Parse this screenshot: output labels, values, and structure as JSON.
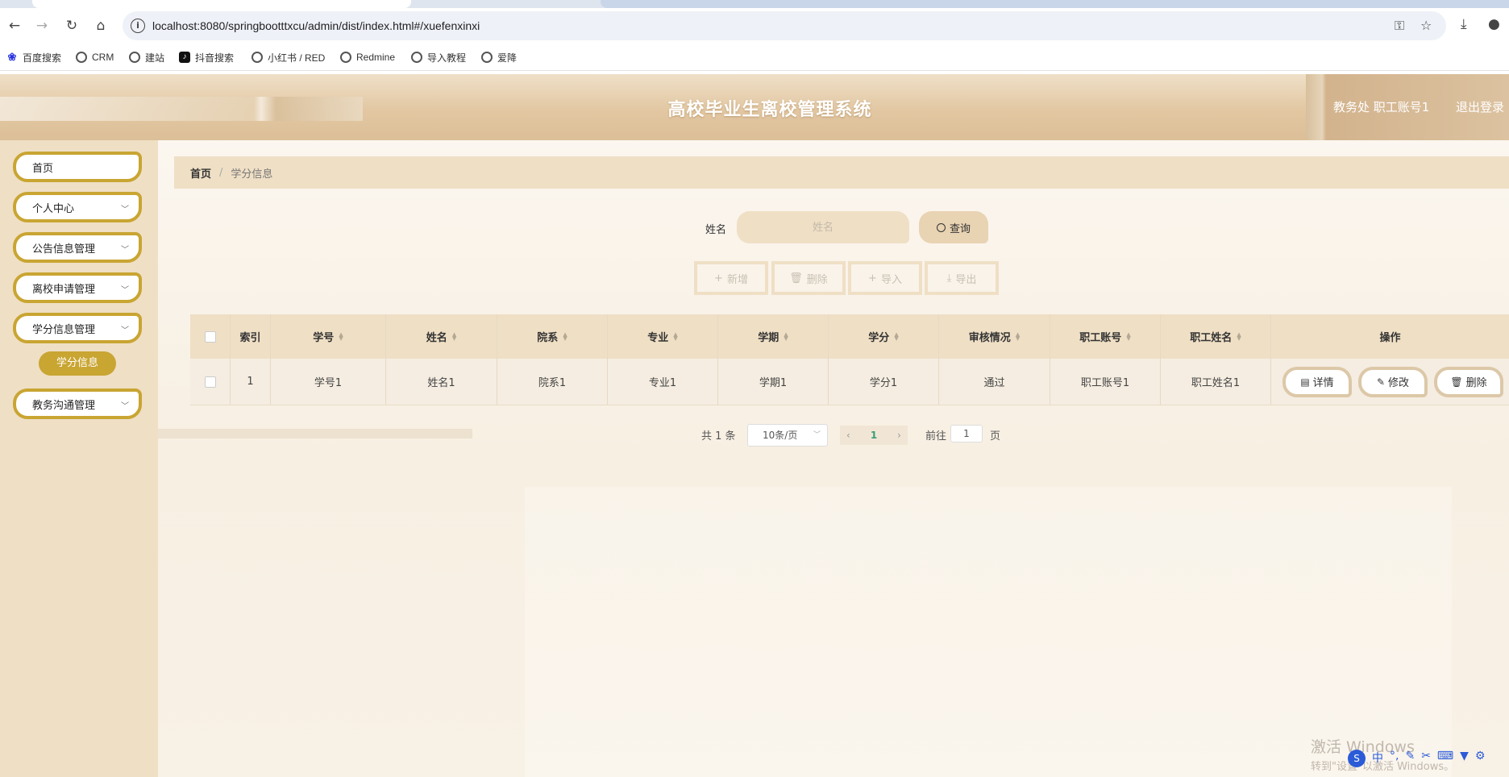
{
  "browser": {
    "url": "localhost:8080/springbootttxcu/admin/dist/index.html#/xuefenxinxi",
    "bookmarks": [
      "百度搜索",
      "CRM",
      "建站",
      "抖音搜索",
      "小红书 / RED",
      "Redmine",
      "导入教程",
      "爱降"
    ]
  },
  "header": {
    "title": "高校毕业生离校管理系统",
    "user": "教务处 职工账号1",
    "logout": "退出登录"
  },
  "sidebar": {
    "items": [
      {
        "label": "首页"
      },
      {
        "label": "个人中心"
      },
      {
        "label": "公告信息管理"
      },
      {
        "label": "离校申请管理"
      },
      {
        "label": "学分信息管理"
      },
      {
        "label": "教务沟通管理"
      }
    ],
    "active_sub": "学分信息"
  },
  "breadcrumb": {
    "home": "首页",
    "sep": "/",
    "current": "学分信息"
  },
  "search": {
    "label": "姓名",
    "placeholder": "姓名",
    "button": "查询"
  },
  "actions": {
    "add": "新增",
    "delete": "删除",
    "import": "导入",
    "export": "导出"
  },
  "table": {
    "columns": [
      "索引",
      "学号",
      "姓名",
      "院系",
      "专业",
      "学期",
      "学分",
      "审核情况",
      "职工账号",
      "职工姓名",
      "操作"
    ],
    "rows": [
      {
        "index": "1",
        "xuehao": "学号1",
        "name": "姓名1",
        "dept": "院系1",
        "major": "专业1",
        "term": "学期1",
        "credit": "学分1",
        "status": "通过",
        "staff_id": "职工账号1",
        "staff_name": "职工姓名1"
      }
    ],
    "ops": {
      "detail": "详情",
      "edit": "修改",
      "remove": "删除"
    }
  },
  "pagination": {
    "total": "共 1 条",
    "page_size": "10条/页",
    "current": "1",
    "goto_label": "前往",
    "goto_value": "1",
    "page_label": "页"
  },
  "watermark": {
    "line1": "激活 Windows",
    "line2": "转到\"设置\"以激活 Windows。"
  },
  "colors": {
    "accent_gold": "#c9a532",
    "panel": "#efdfc5",
    "status_green": "#3a9e77"
  }
}
